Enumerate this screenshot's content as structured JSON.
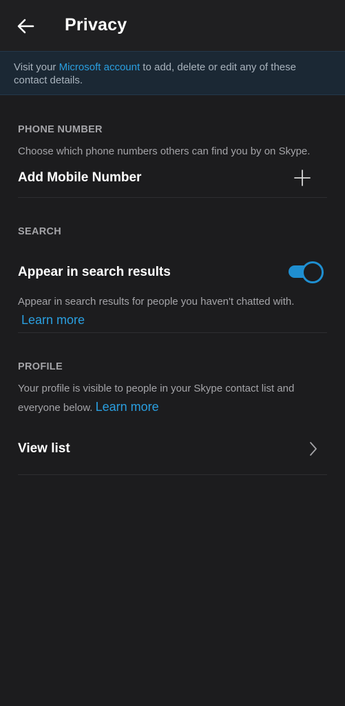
{
  "header": {
    "title": "Privacy",
    "back_icon": "arrow-left-icon"
  },
  "banner": {
    "text_before": "Visit your ",
    "link": "Microsoft account",
    "text_after": " to add, delete or edit any of these contact details."
  },
  "phone_section": {
    "label": "PHONE NUMBER",
    "description": "Choose which phone numbers others can find you by on Skype.",
    "add_label": "Add Mobile Number",
    "add_icon": "plus-icon"
  },
  "search_section": {
    "label": "SEARCH",
    "toggle_label": "Appear in search results",
    "toggle_on": true,
    "description": "Appear in search results for people you haven't chatted with.",
    "learn_more": "Learn more"
  },
  "profile_section": {
    "label": "PROFILE",
    "description": "Your profile is visible to people in your Skype contact list and everyone below.",
    "learn_more": "Learn more",
    "view_list_label": "View list",
    "chevron_icon": "chevron-right-icon"
  },
  "colors": {
    "background": "#1c1c1e",
    "accent": "#2a9fe0",
    "toggle": "#1f8fd1",
    "secondary_text": "#a4a4a8",
    "banner_bg": "#1b2834"
  }
}
